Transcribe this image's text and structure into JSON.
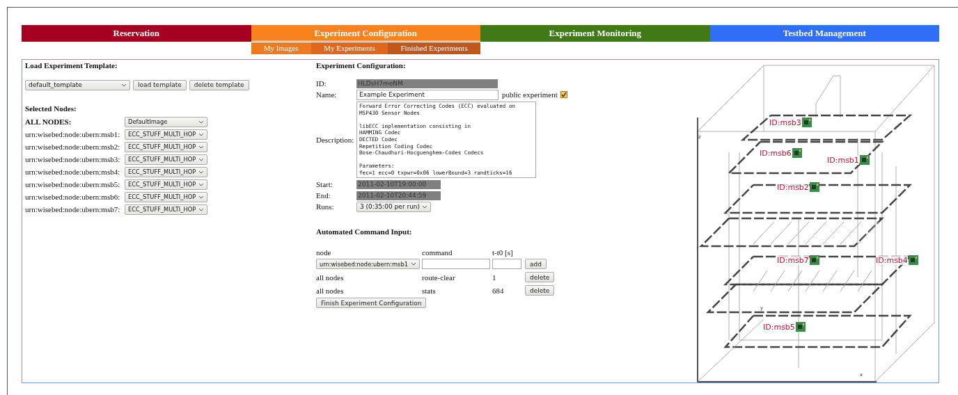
{
  "tabs": [
    {
      "label": "Reservation",
      "color": "#a50021",
      "selected": false
    },
    {
      "label": "Experiment Configuration",
      "color": "#f8821e",
      "selected": true,
      "subtabs": [
        {
          "label": "My Images",
          "selected": false
        },
        {
          "label": "My Experiments",
          "selected": false
        },
        {
          "label": "Finished Experiments",
          "selected": true
        }
      ]
    },
    {
      "label": "Experiment Monitoring",
      "color": "#3f7a17",
      "selected": false
    },
    {
      "label": "Testbed Management",
      "color": "#2f6ef7",
      "selected": false
    }
  ],
  "template": {
    "heading": "Load Experiment Template:",
    "select": "default_template",
    "buttons": [
      "load template",
      "delete template"
    ]
  },
  "nodes": {
    "heading": "Selected Nodes:",
    "all_label": "ALL NODES:",
    "all_value": "DefaultImage",
    "rows": [
      {
        "label": "urn:wisebed:node:ubern:msb1:",
        "value": "ECC_STUFF_MULTI_HOP"
      },
      {
        "label": "urn:wisebed:node:ubern:msb2:",
        "value": "ECC_STUFF_MULTI_HOP"
      },
      {
        "label": "urn:wisebed:node:ubern:msb3:",
        "value": "ECC_STUFF_MULTI_HOP"
      },
      {
        "label": "urn:wisebed:node:ubern:msb4:",
        "value": "ECC_STUFF_MULTI_HOP"
      },
      {
        "label": "urn:wisebed:node:ubern:msb5:",
        "value": "ECC_STUFF_MULTI_HOP"
      },
      {
        "label": "urn:wisebed:node:ubern:msb6:",
        "value": "ECC_STUFF_MULTI_HOP"
      },
      {
        "label": "urn:wisebed:node:ubern:msb7:",
        "value": "ECC_STUFF_MULTI_HOP"
      }
    ]
  },
  "config": {
    "heading": "Experiment Configuration:",
    "id_label": "ID:",
    "id_value": "HLDsH7meNM",
    "name_label": "Name:",
    "name_value": "Example Experiment",
    "public_label": "public experiment",
    "public_checked": true,
    "description_label": "Description:",
    "description": "Forward Error Correcting Codes (ECC) evaluated on\nMSP430 Sensor Nodes\n\nlibECC implementation consisting in\nHAMMING Codec\nDECTED Codec\nRepetition Coding Codec\nBose-Chaudhuri-Hocguenghem-Codes Codecs\n\nParameters:\nfec=1 ecc=0 txpwr=0x06 lowerBound=3 randticks=16",
    "start_label": "Start:",
    "start": "2011-02-10T19:00:00",
    "end_label": "End:",
    "end": "2011-02-10T20:44:59",
    "runs_label": "Runs:",
    "runs": "3 (0:35:00 per run)"
  },
  "commands": {
    "heading": "Automated Command Input:",
    "columns": [
      "node",
      "command",
      "t-t0 [s]"
    ],
    "node_select": "urn:wisebed:node:ubern:msb1",
    "add": "add",
    "rows": [
      {
        "node": "all nodes",
        "command": "route-clear",
        "t0": "1",
        "button": "delete"
      },
      {
        "node": "all nodes",
        "command": "stats",
        "t0": "684",
        "button": "delete"
      }
    ],
    "finish": "Finish Experiment Configuration"
  },
  "visualization": {
    "axes": [
      "z",
      "y",
      "x"
    ],
    "nodes": [
      {
        "label": "ID:msb3"
      },
      {
        "label": "ID:msb6"
      },
      {
        "label": "ID:msb1"
      },
      {
        "label": "ID:msb2"
      },
      {
        "label": "ID:msb7"
      },
      {
        "label": "ID:msb4"
      },
      {
        "label": "ID:msb5"
      }
    ]
  }
}
